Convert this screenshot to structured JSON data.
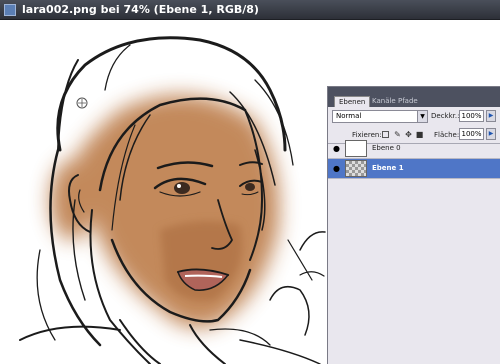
{
  "window": {
    "title": "lara002.png bei 74% (Ebene 1, RGB/8)"
  },
  "layers_panel": {
    "tabs": [
      {
        "label": "Ebenen",
        "active": true
      },
      {
        "label": "Kanäle",
        "active": false
      },
      {
        "label": "Pfade",
        "active": false
      }
    ],
    "blend_mode": "Normal",
    "opacity_label": "Deckkr.:",
    "opacity_value": "100%",
    "lock_label": "Fixieren:",
    "fill_label": "Fläche:",
    "fill_value": "100%",
    "lock_icons": [
      "lock-transparent-icon",
      "lock-brush-icon",
      "lock-move-icon",
      "lock-all-icon"
    ],
    "layers": [
      {
        "name": "Ebene 0",
        "visible": true,
        "selected": false,
        "thumbnail": "sketch-thumbnail"
      },
      {
        "name": "Ebene 1",
        "visible": true,
        "selected": true,
        "thumbnail": "transparent-thumbnail"
      }
    ]
  },
  "colors": {
    "skin": "#c08352",
    "selection": "#4f76c7",
    "lips": "#b0645a",
    "titlebar": "#2d3038"
  }
}
